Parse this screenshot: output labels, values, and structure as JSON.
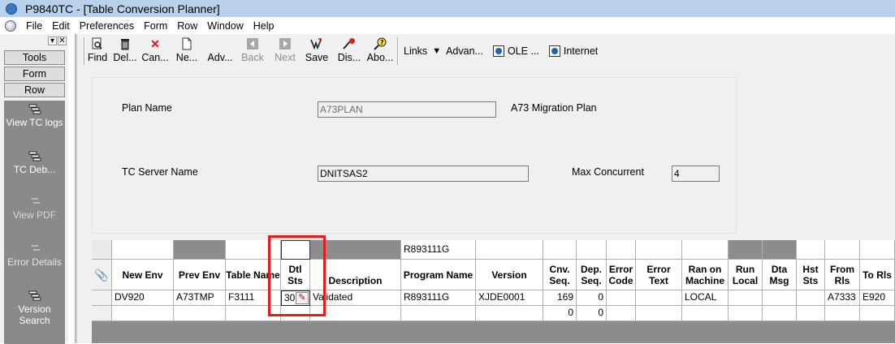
{
  "window": {
    "title": "P9840TC - [Table Conversion Planner]"
  },
  "menu": [
    "File",
    "Edit",
    "Preferences",
    "Form",
    "Row",
    "Window",
    "Help"
  ],
  "left_pane": {
    "buttons": [
      "Tools",
      "Form",
      "Row"
    ],
    "items": [
      {
        "label": "View TC logs",
        "icon": "row-exit-icon"
      },
      {
        "label": "TC Deb...",
        "icon": "row-exit-icon"
      },
      {
        "label": "View PDF",
        "icon": "row-exit-icon"
      },
      {
        "label": "Error Details",
        "icon": "row-exit-icon"
      },
      {
        "label": "Version Search",
        "icon": "row-exit-icon"
      }
    ]
  },
  "toolbar": {
    "buttons": [
      {
        "label": "Find",
        "icon": "find-icon",
        "enabled": true
      },
      {
        "label": "Del...",
        "icon": "trash-icon",
        "enabled": true
      },
      {
        "label": "Can...",
        "icon": "cancel-x-icon",
        "enabled": true
      },
      {
        "label": "Ne...",
        "icon": "new-icon",
        "enabled": true
      },
      {
        "label": "Adv...",
        "icon": "advanced-icon",
        "enabled": true
      },
      {
        "label": "Back",
        "icon": "back-arrow-icon",
        "enabled": false
      },
      {
        "label": "Next",
        "icon": "next-arrow-icon",
        "enabled": false
      },
      {
        "label": "Save",
        "icon": "save-icon",
        "enabled": true
      },
      {
        "label": "Dis...",
        "icon": "display-icon",
        "enabled": true
      },
      {
        "label": "Abo...",
        "icon": "about-icon",
        "enabled": true
      }
    ],
    "links": [
      {
        "label": "Links",
        "icon": "dropdown-arrow-icon"
      },
      {
        "label": "Advan...",
        "icon": ""
      },
      {
        "label": "OLE ...",
        "icon": "ole-icon"
      },
      {
        "label": "Internet",
        "icon": "internet-icon"
      }
    ]
  },
  "form": {
    "plan_name_label": "Plan Name",
    "plan_name_value": "A73PLAN",
    "plan_desc": "A73  Migration Plan",
    "server_label": "TC Server Name",
    "server_value": "DNITSAS2",
    "max_concurrent_label": "Max Concurrent",
    "max_concurrent_value": "4"
  },
  "grid": {
    "qbe_program": "R893111G",
    "columns": [
      "New Env",
      "Prev Env",
      "Table Name",
      "Dtl Sts",
      "Description",
      "Program Name",
      "Version",
      "Cnv. Seq.",
      "Dep. Seq.",
      "Error Code",
      "Error Text",
      "Ran on Machine",
      "Run Local",
      "Dta Msg",
      "Hst Sts",
      "From Rls",
      "To Rls"
    ],
    "rows": [
      [
        "DV920",
        "A73TMP",
        "F3111",
        "30",
        "Validated",
        "R893111G",
        "XJDE0001",
        "169",
        "0",
        "",
        "",
        "LOCAL",
        "",
        "",
        "",
        "A7333",
        "E920"
      ],
      [
        "",
        "",
        "",
        "",
        "",
        "",
        "",
        "0",
        "0",
        "",
        "",
        "",
        "",
        "",
        "",
        "",
        ""
      ]
    ],
    "highlight_color": "#e81b1b"
  }
}
